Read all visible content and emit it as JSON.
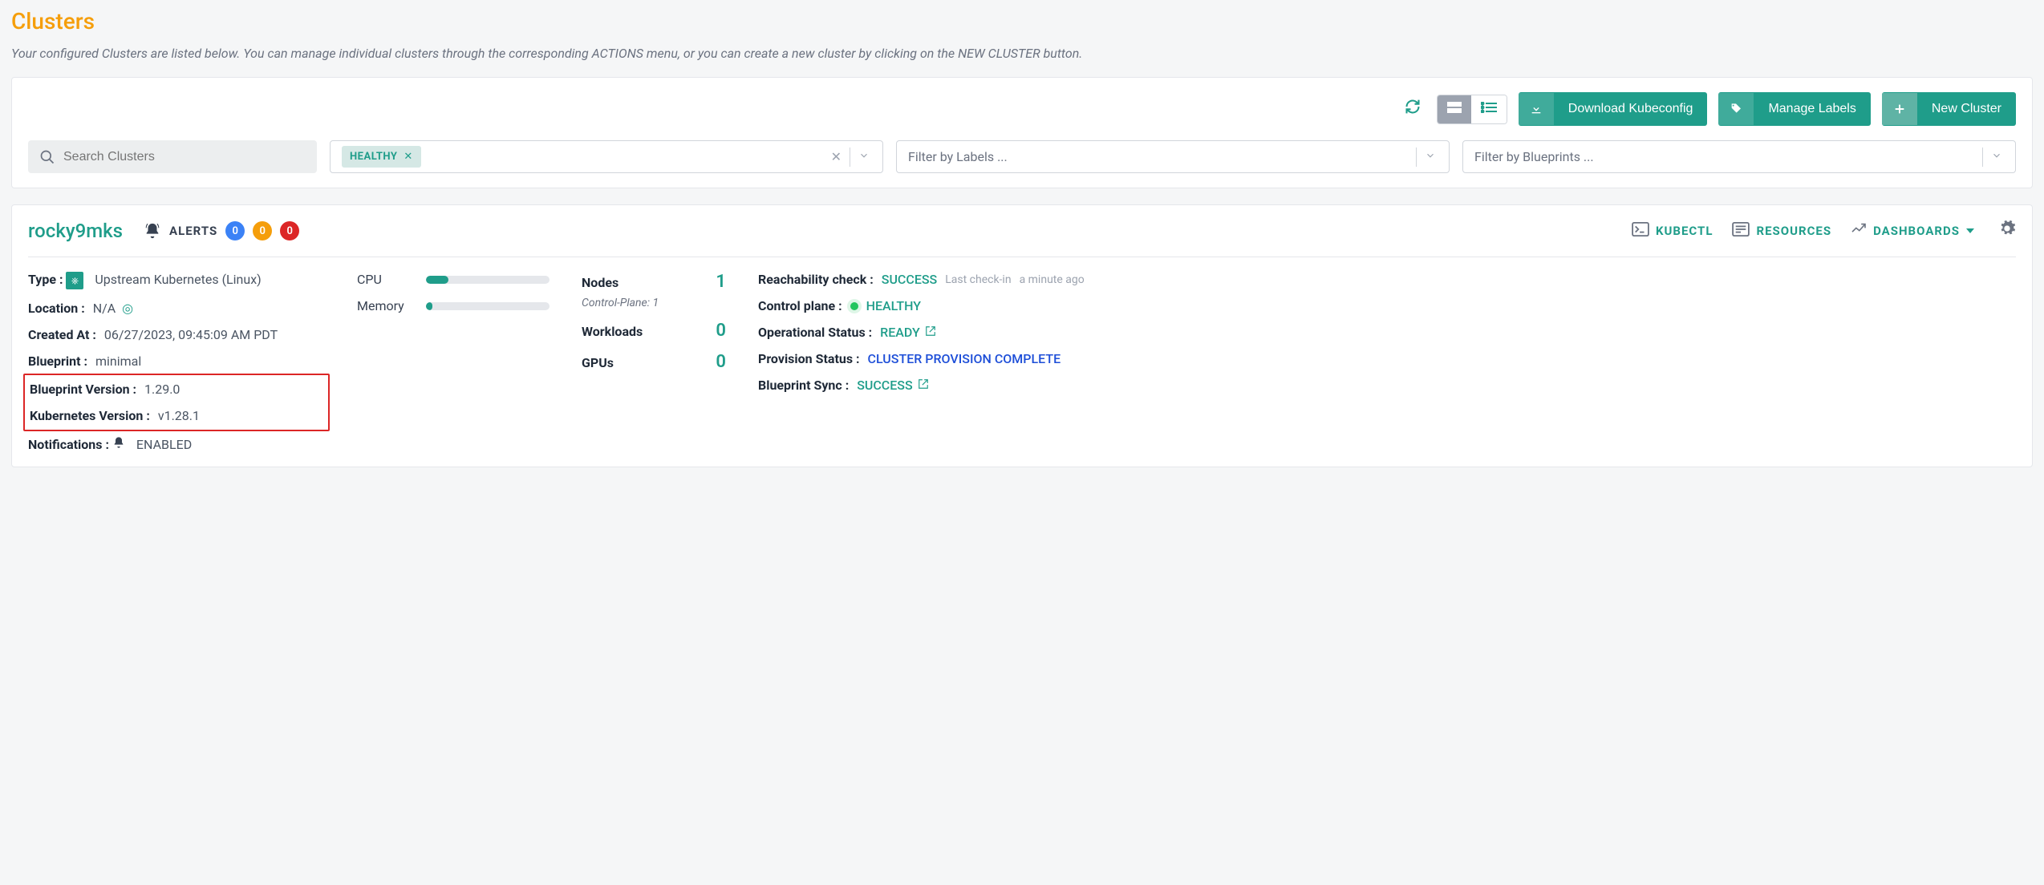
{
  "page": {
    "title": "Clusters",
    "subtitle": "Your configured Clusters are listed below. You can manage individual clusters through the corresponding ACTIONS menu, or you can create a new cluster by clicking on the NEW CLUSTER button."
  },
  "toolbar": {
    "download_label": "Download Kubeconfig",
    "manage_labels_label": "Manage Labels",
    "new_cluster_label": "New Cluster"
  },
  "filters": {
    "search_placeholder": "Search Clusters",
    "health_chip": "HEALTHY",
    "labels_placeholder": "Filter by Labels ...",
    "blueprints_placeholder": "Filter by Blueprints ..."
  },
  "cluster": {
    "name": "rocky9mks",
    "alerts_label": "ALERTS",
    "alerts": {
      "blue": "0",
      "orange": "0",
      "red": "0"
    },
    "links": {
      "kubectl": "KUBECTL",
      "resources": "RESOURCES",
      "dashboards": "DASHBOARDS"
    },
    "meta": {
      "type_label": "Type :",
      "type_value": "Upstream Kubernetes (Linux)",
      "location_label": "Location :",
      "location_value": "N/A",
      "created_label": "Created At :",
      "created_value": "06/27/2023, 09:45:09 AM PDT",
      "blueprint_label": "Blueprint :",
      "blueprint_value": "minimal",
      "blueprint_version_label": "Blueprint Version :",
      "blueprint_version_value": "1.29.0",
      "k8s_version_label": "Kubernetes Version :",
      "k8s_version_value": "v1.28.1",
      "notifications_label": "Notifications :",
      "notifications_value": "ENABLED"
    },
    "usage": {
      "cpu_label": "CPU",
      "cpu_pct": 18,
      "mem_label": "Memory",
      "mem_pct": 5
    },
    "counts": {
      "nodes_label": "Nodes",
      "nodes_value": "1",
      "control_plane_label": "Control-Plane: 1",
      "workloads_label": "Workloads",
      "workloads_value": "0",
      "gpus_label": "GPUs",
      "gpus_value": "0"
    },
    "status": {
      "reach_label": "Reachability check :",
      "reach_value": "SUCCESS",
      "reach_meta_1": "Last check-in",
      "reach_meta_2": "a minute ago",
      "cp_label": "Control plane :",
      "cp_value": "HEALTHY",
      "op_label": "Operational Status :",
      "op_value": "READY",
      "prov_label": "Provision Status :",
      "prov_value": "CLUSTER PROVISION COMPLETE",
      "bp_label": "Blueprint Sync :",
      "bp_value": "SUCCESS"
    }
  }
}
